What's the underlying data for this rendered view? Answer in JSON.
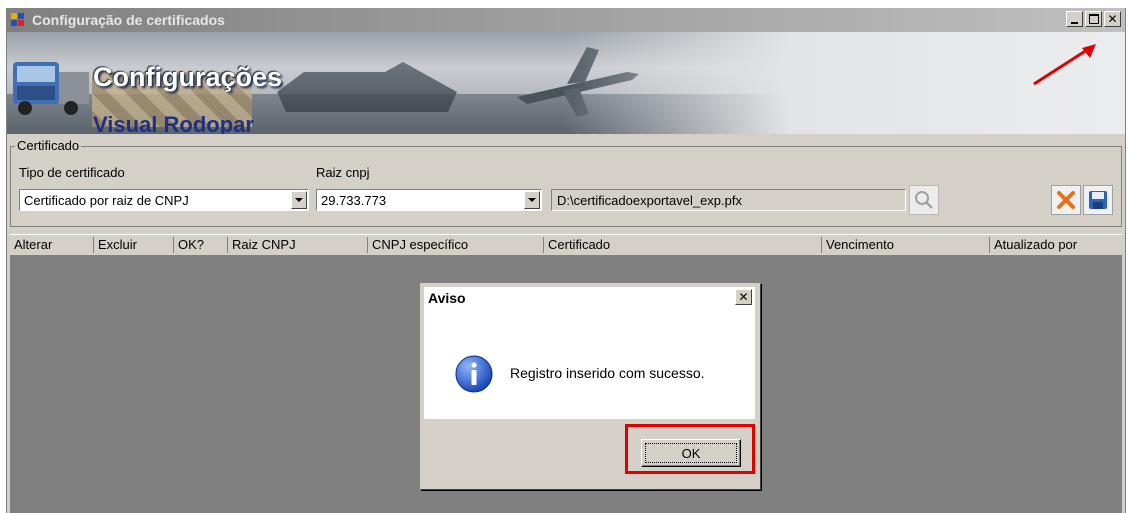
{
  "window": {
    "title": "Configuração de certificados"
  },
  "banner": {
    "heading": "Configurações",
    "subheading": "Visual Rodopar"
  },
  "certificado": {
    "group_label": "Certificado",
    "tipo_label": "Tipo de certificado",
    "tipo_value": "Certificado por raiz de CNPJ",
    "raiz_label": "Raiz cnpj",
    "raiz_value": "29.733.773",
    "path_value": "D:\\certificadoexportavel_exp.pfx"
  },
  "grid": {
    "columns": [
      "Alterar",
      "Excluir",
      "OK?",
      "Raiz CNPJ",
      "CNPJ específico",
      "Certificado",
      "Vencimento",
      "Atualizado por"
    ]
  },
  "dialog": {
    "title": "Aviso",
    "message": "Registro inserido com sucesso.",
    "ok_label": "OK",
    "icon": "info-icon"
  },
  "colors": {
    "highlight": "#e00000",
    "arrow": "#e00000"
  }
}
